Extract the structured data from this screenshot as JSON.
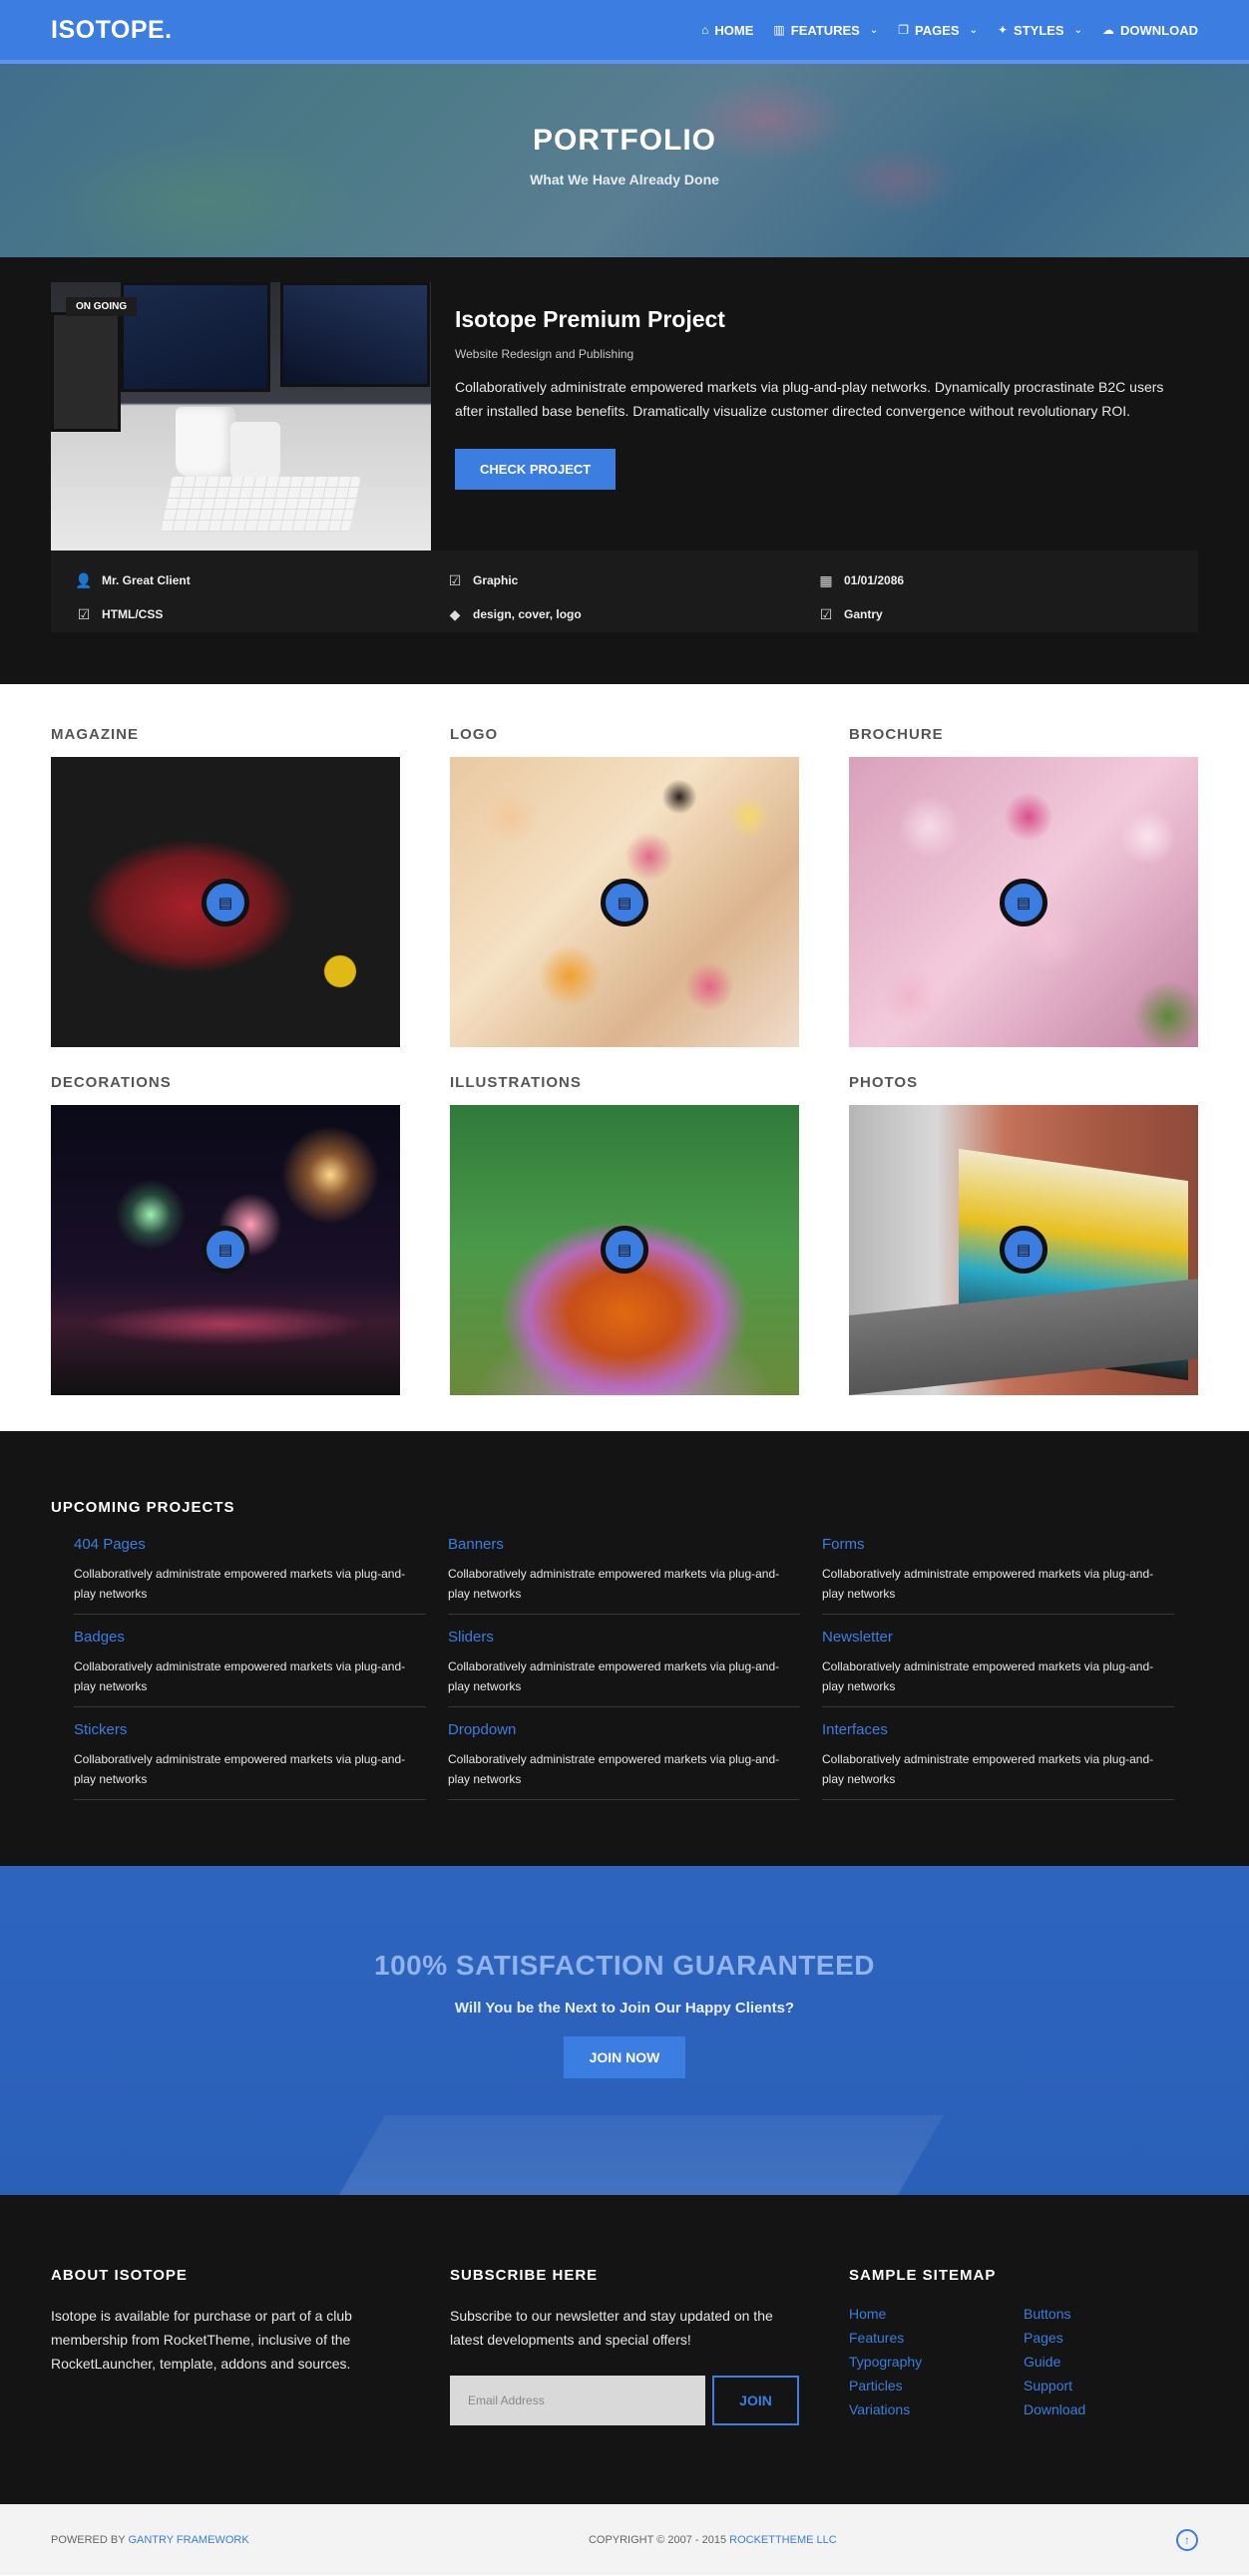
{
  "header": {
    "logo": "ISOTOPE.",
    "nav": [
      {
        "icon": "home-icon",
        "glyph": "⌂",
        "label": "HOME",
        "dropdown": false
      },
      {
        "icon": "bar-chart-icon",
        "glyph": "▥",
        "label": "FEATURES",
        "dropdown": true
      },
      {
        "icon": "pages-icon",
        "glyph": "❐",
        "label": "PAGES",
        "dropdown": true
      },
      {
        "icon": "styles-icon",
        "glyph": "✦",
        "label": "STYLES",
        "dropdown": true
      },
      {
        "icon": "download-cloud-icon",
        "glyph": "☁",
        "label": "DOWNLOAD",
        "dropdown": false
      }
    ],
    "title": "PORTFOLIO",
    "subtitle": "What We Have Already Done"
  },
  "featured": {
    "badge": "ON GOING",
    "title": "Isotope Premium Project",
    "subtitle": "Website Redesign and Publishing",
    "description": "Collaboratively administrate empowered markets via plug-and-play networks. Dynamically procrastinate B2C users after installed base benefits. Dramatically visualize customer directed convergence without revolutionary ROI.",
    "button": "CHECK PROJECT",
    "meta": [
      {
        "icon": "user-icon",
        "label": "Mr. Great Client"
      },
      {
        "icon": "checkbox-icon",
        "label": "Graphic"
      },
      {
        "icon": "calendar-icon",
        "label": "01/01/2086"
      },
      {
        "icon": "checkbox-icon",
        "label": "HTML/CSS"
      },
      {
        "icon": "tag-icon",
        "label": "design, cover, logo"
      },
      {
        "icon": "checkbox-icon",
        "label": "Gantry"
      }
    ]
  },
  "portfolio": [
    {
      "title": "MAGAZINE",
      "image": "img-tractor"
    },
    {
      "title": "LOGO",
      "image": "img-candy"
    },
    {
      "title": "BROCHURE",
      "image": "img-blossom"
    },
    {
      "title": "DECORATIONS",
      "image": "img-fireworks"
    },
    {
      "title": "ILLUSTRATIONS",
      "image": "img-flower"
    },
    {
      "title": "PHOTOS",
      "image": "img-tram"
    }
  ],
  "upcoming": {
    "title": "UPCOMING PROJECTS",
    "items": [
      {
        "title": "404 Pages",
        "desc": "Collaboratively administrate empowered markets via plug-and-play networks"
      },
      {
        "title": "Banners",
        "desc": "Collaboratively administrate empowered markets via plug-and-play networks"
      },
      {
        "title": "Forms",
        "desc": "Collaboratively administrate empowered markets via plug-and-play networks"
      },
      {
        "title": "Badges",
        "desc": "Collaboratively administrate empowered markets via plug-and-play networks"
      },
      {
        "title": "Sliders",
        "desc": "Collaboratively administrate empowered markets via plug-and-play networks"
      },
      {
        "title": "Newsletter",
        "desc": "Collaboratively administrate empowered markets via plug-and-play networks"
      },
      {
        "title": "Stickers",
        "desc": "Collaboratively administrate empowered markets via plug-and-play networks"
      },
      {
        "title": "Dropdown",
        "desc": "Collaboratively administrate empowered markets via plug-and-play networks"
      },
      {
        "title": "Interfaces",
        "desc": "Collaboratively administrate empowered markets via plug-and-play networks"
      }
    ]
  },
  "satisfaction": {
    "title": "100% SATISFACTION GUARANTEED",
    "subtitle": "Will You be the Next to Join Our Happy Clients?",
    "button": "JOIN NOW"
  },
  "footer": {
    "about_title": "ABOUT ISOTOPE",
    "about_text": "Isotope is available for purchase or part of a club membership from RocketTheme, inclusive of the RocketLauncher, template, addons and sources.",
    "subscribe_title": "SUBSCRIBE HERE",
    "subscribe_text": "Subscribe to our newsletter and stay updated on the latest developments and special offers!",
    "email_placeholder": "Email Address",
    "join_button": "JOIN",
    "sitemap_title": "SAMPLE SITEMAP",
    "sitemap": [
      "Home",
      "Buttons",
      "Features",
      "Pages",
      "Typography",
      "Guide",
      "Particles",
      "Support",
      "Variations",
      "Download"
    ]
  },
  "copyright": {
    "powered_prefix": "POWERED BY ",
    "powered_link": "GANTRY FRAMEWORK",
    "copy_prefix": "COPYRIGHT © 2007 - 2015 ",
    "copy_link": "ROCKETTHEME LLC",
    "to_top_glyph": "↑"
  },
  "colors": {
    "accent": "#3b7de0",
    "dark": "#141414",
    "banner": "#2d64bf"
  }
}
